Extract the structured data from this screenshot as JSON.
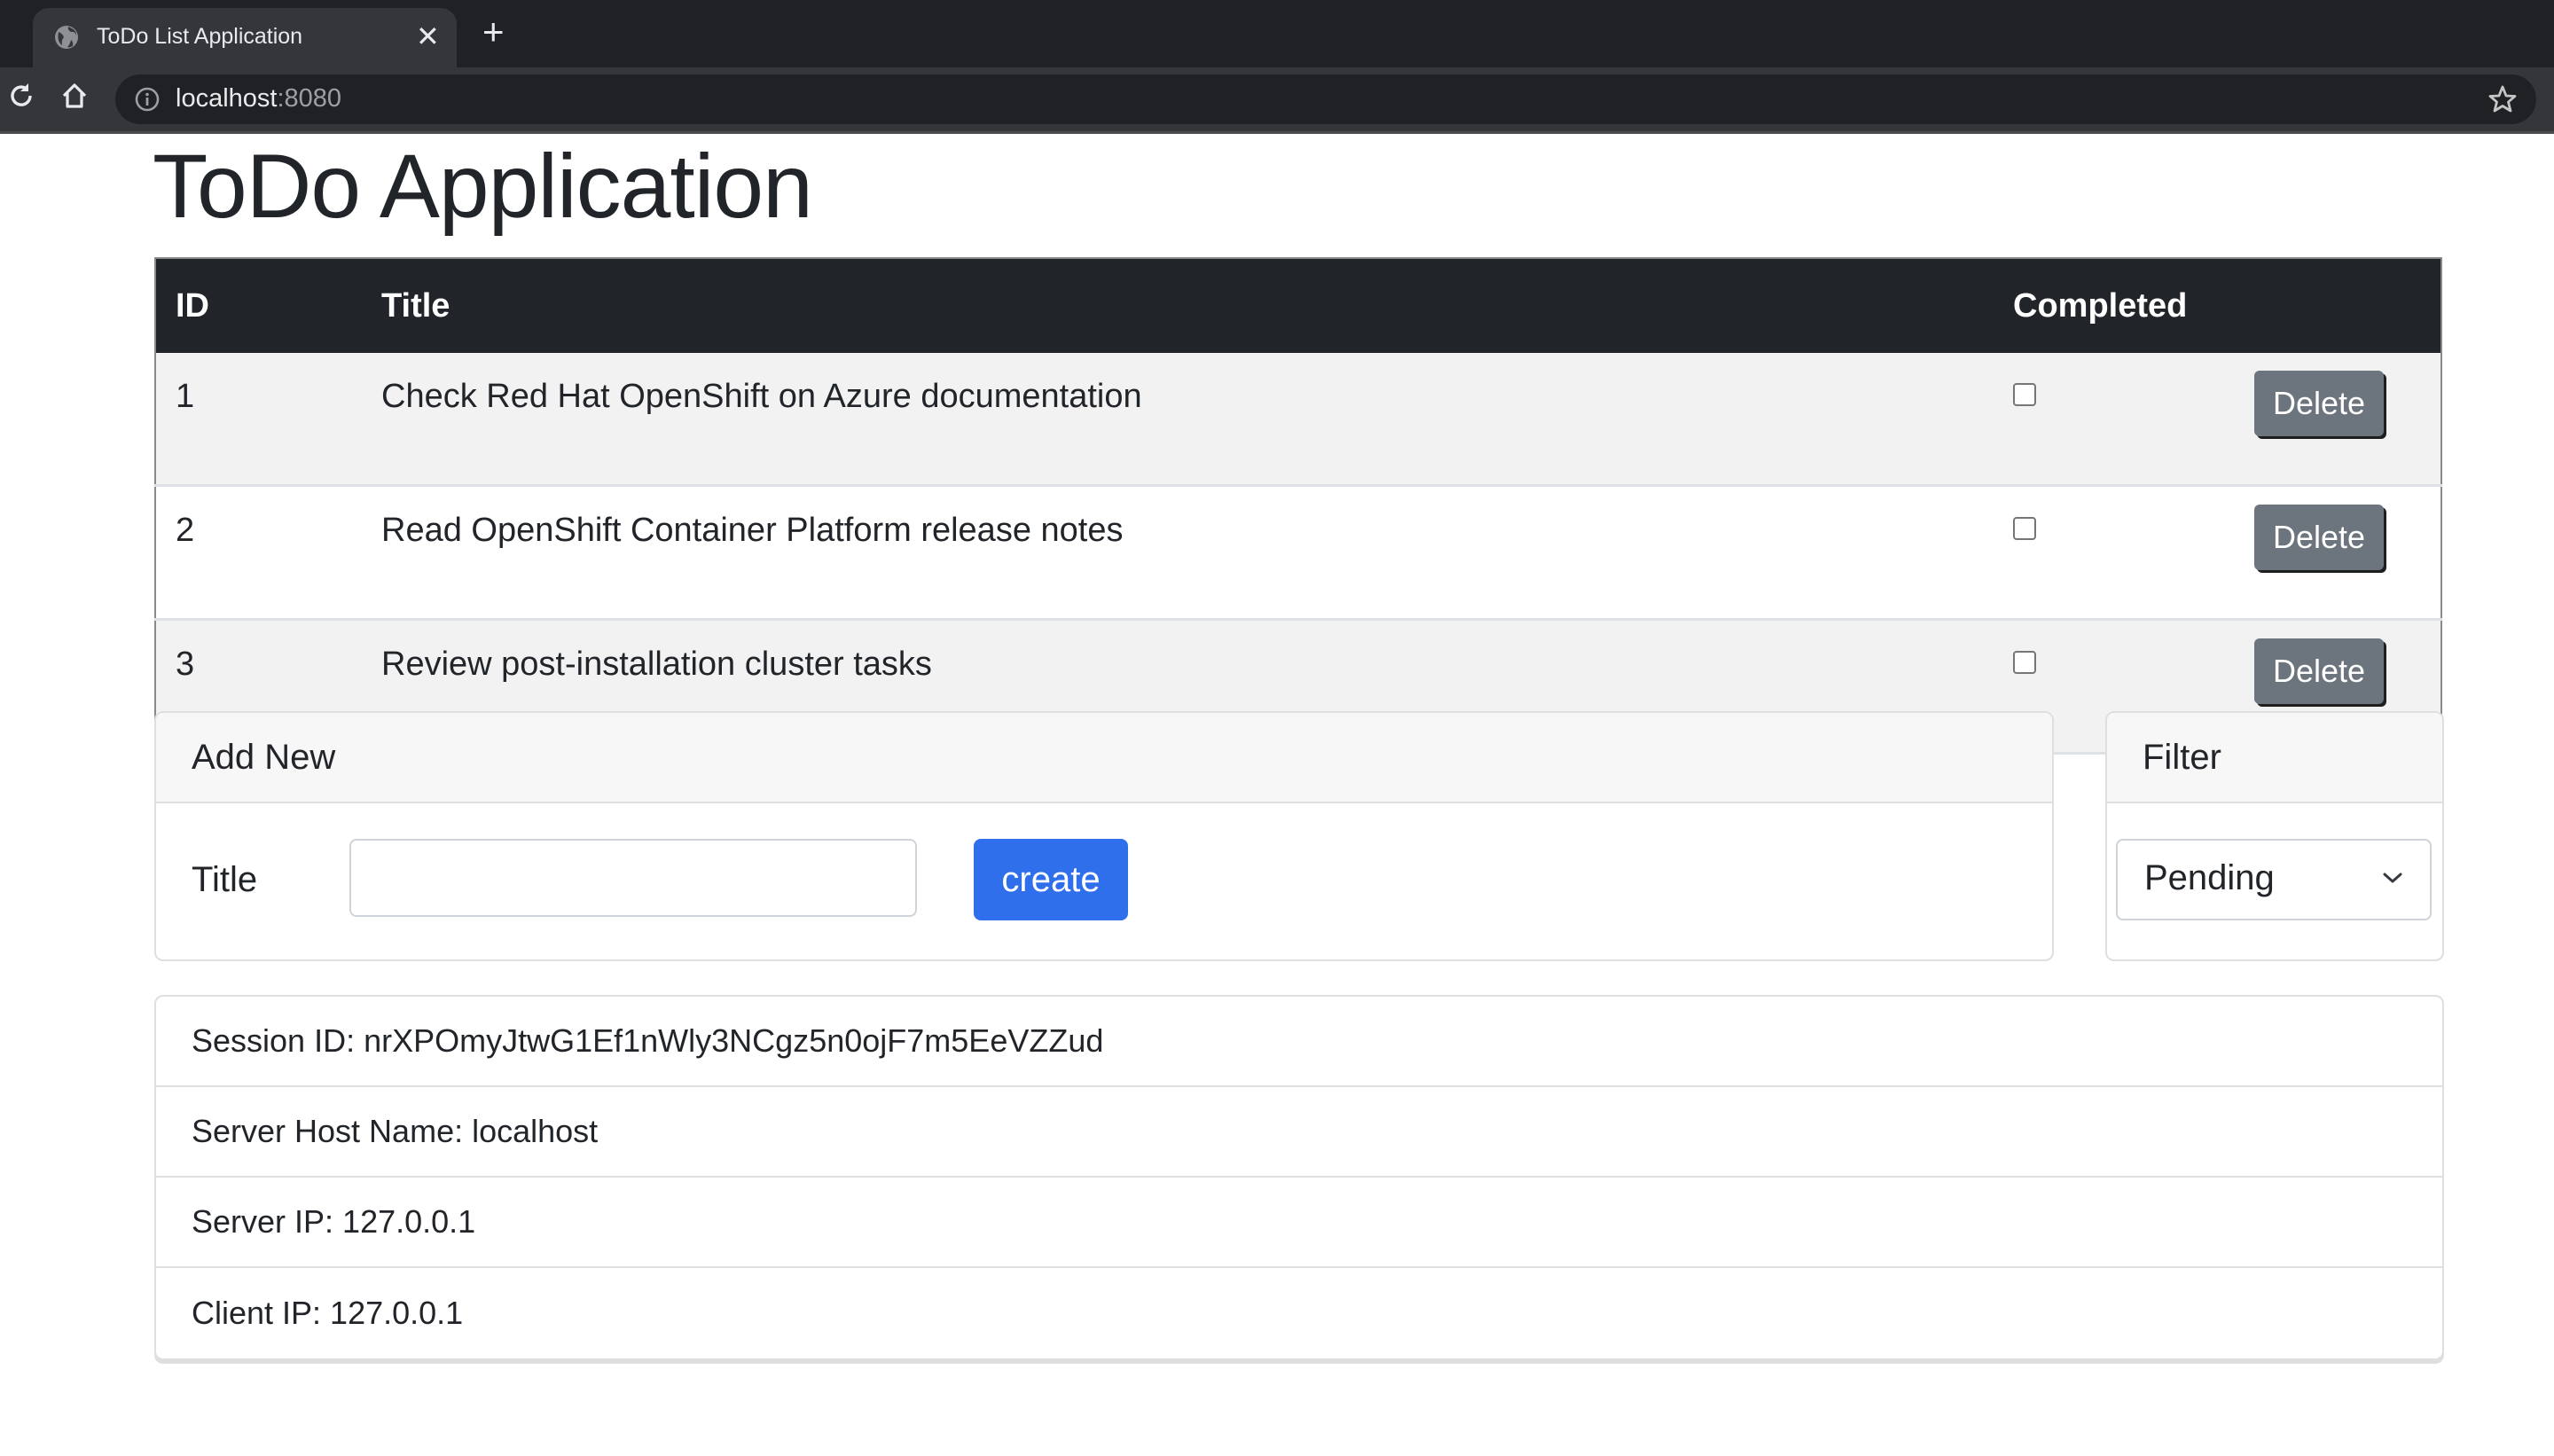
{
  "browser": {
    "tab_title": "ToDo List Application",
    "tab_close": "✕",
    "new_tab": "+",
    "url_host": "localhost",
    "url_port": ":8080"
  },
  "page": {
    "title": "ToDo Application"
  },
  "table": {
    "headers": {
      "id": "ID",
      "title": "Title",
      "completed": "Completed"
    },
    "rows": [
      {
        "id": "1",
        "title": "Check Red Hat OpenShift on Azure documentation",
        "completed": false,
        "delete_label": "Delete"
      },
      {
        "id": "2",
        "title": "Read OpenShift Container Platform release notes",
        "completed": false,
        "delete_label": "Delete"
      },
      {
        "id": "3",
        "title": "Review post-installation cluster tasks",
        "completed": false,
        "delete_label": "Delete"
      }
    ]
  },
  "add_new": {
    "header": "Add New",
    "title_label": "Title",
    "title_value": "",
    "title_placeholder": "",
    "create_label": "create"
  },
  "filter": {
    "header": "Filter",
    "selected": "Pending"
  },
  "info": {
    "items": [
      "Session ID: nrXPOmyJtwG1Ef1nWly3NCgz5n0ojF7m5EeVZZud",
      "Server Host Name: localhost",
      "Server IP: 127.0.0.1",
      "Client IP: 127.0.0.1"
    ]
  },
  "colors": {
    "table_header_bg": "#212529",
    "delete_button": "#6c757d",
    "create_button": "#2f6fec",
    "stripe": "#f2f2f2"
  }
}
